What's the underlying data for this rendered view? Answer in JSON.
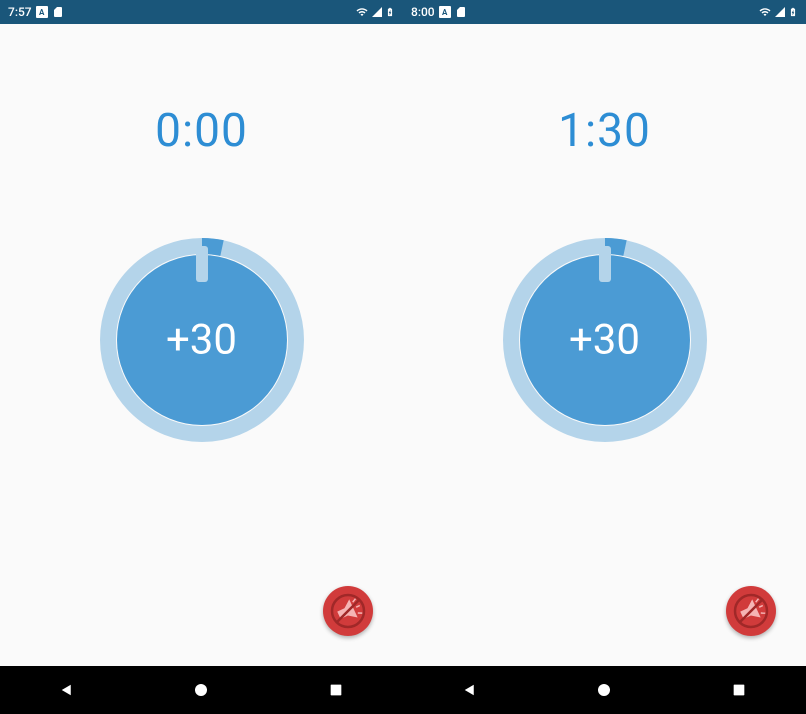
{
  "screens": [
    {
      "status": {
        "time": "7:57"
      },
      "timer_display": "0:00",
      "dial_label": "+30"
    },
    {
      "status": {
        "time": "8:00"
      },
      "timer_display": "1:30",
      "dial_label": "+30"
    }
  ],
  "status_icons": {
    "a_label": "A"
  },
  "colors": {
    "status_bar": "#1a567a",
    "accent": "#2d8dd4",
    "dial_fill": "#4b9bd4",
    "dial_ring": "#b4d4ea",
    "mute_button": "#d13b3b"
  }
}
